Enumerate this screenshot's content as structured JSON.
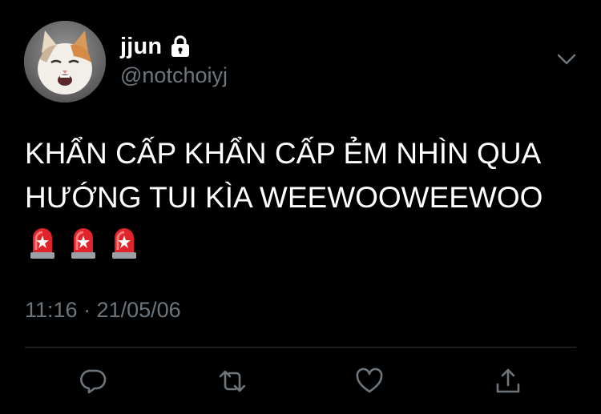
{
  "user": {
    "display_name": "jjun",
    "handle": "@notchoiyj",
    "protected_icon": "lock-icon"
  },
  "tweet": {
    "text_lines": [
      "KHẨN CẤP KHẨN CẤP ẺM NHÌN QUA",
      "HƯỚNG TUI KÌA WEEWOOWEEWOO"
    ],
    "emojis": [
      "🚨",
      "🚨",
      "🚨"
    ],
    "timestamp": "11:16 · 21/05/06"
  },
  "actions": [
    {
      "icon": "reply-icon"
    },
    {
      "icon": "retweet-icon"
    },
    {
      "icon": "like-icon"
    },
    {
      "icon": "share-icon"
    }
  ],
  "menu_icon": "chevron-down-icon",
  "colors": {
    "background": "#000000",
    "text_primary": "#ffffff",
    "text_secondary": "#6e767d",
    "divider": "#2f3336",
    "siren_red": "#e0242b"
  }
}
